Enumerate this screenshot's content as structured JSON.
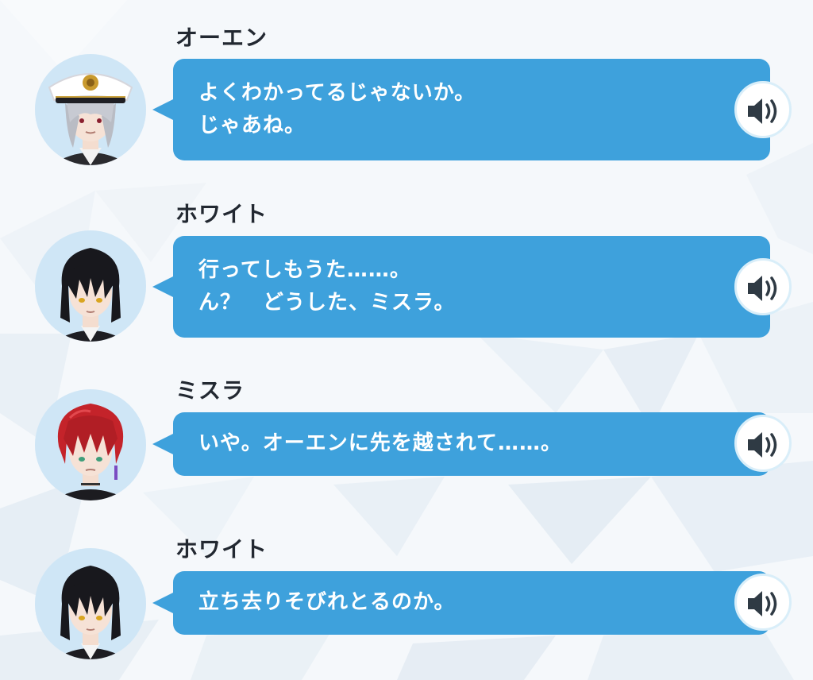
{
  "accent_color": "#3ea1dc",
  "text_color": "#ffffff",
  "name_color": "#222831",
  "voice_icon": "speaker-icon",
  "entries": [
    {
      "speaker": "オーエン",
      "avatar": "owen-avatar",
      "lines": [
        "よくわかってるじゃないか。",
        "じゃあね。"
      ]
    },
    {
      "speaker": "ホワイト",
      "avatar": "white-avatar",
      "lines": [
        "行ってしもうた……。",
        "ん？　どうした、ミスラ。"
      ]
    },
    {
      "speaker": "ミスラ",
      "avatar": "mithra-avatar",
      "lines": [
        "いや。オーエンに先を越されて……。"
      ]
    },
    {
      "speaker": "ホワイト",
      "avatar": "white-avatar",
      "lines": [
        "立ち去りそびれとるのか。"
      ]
    }
  ]
}
